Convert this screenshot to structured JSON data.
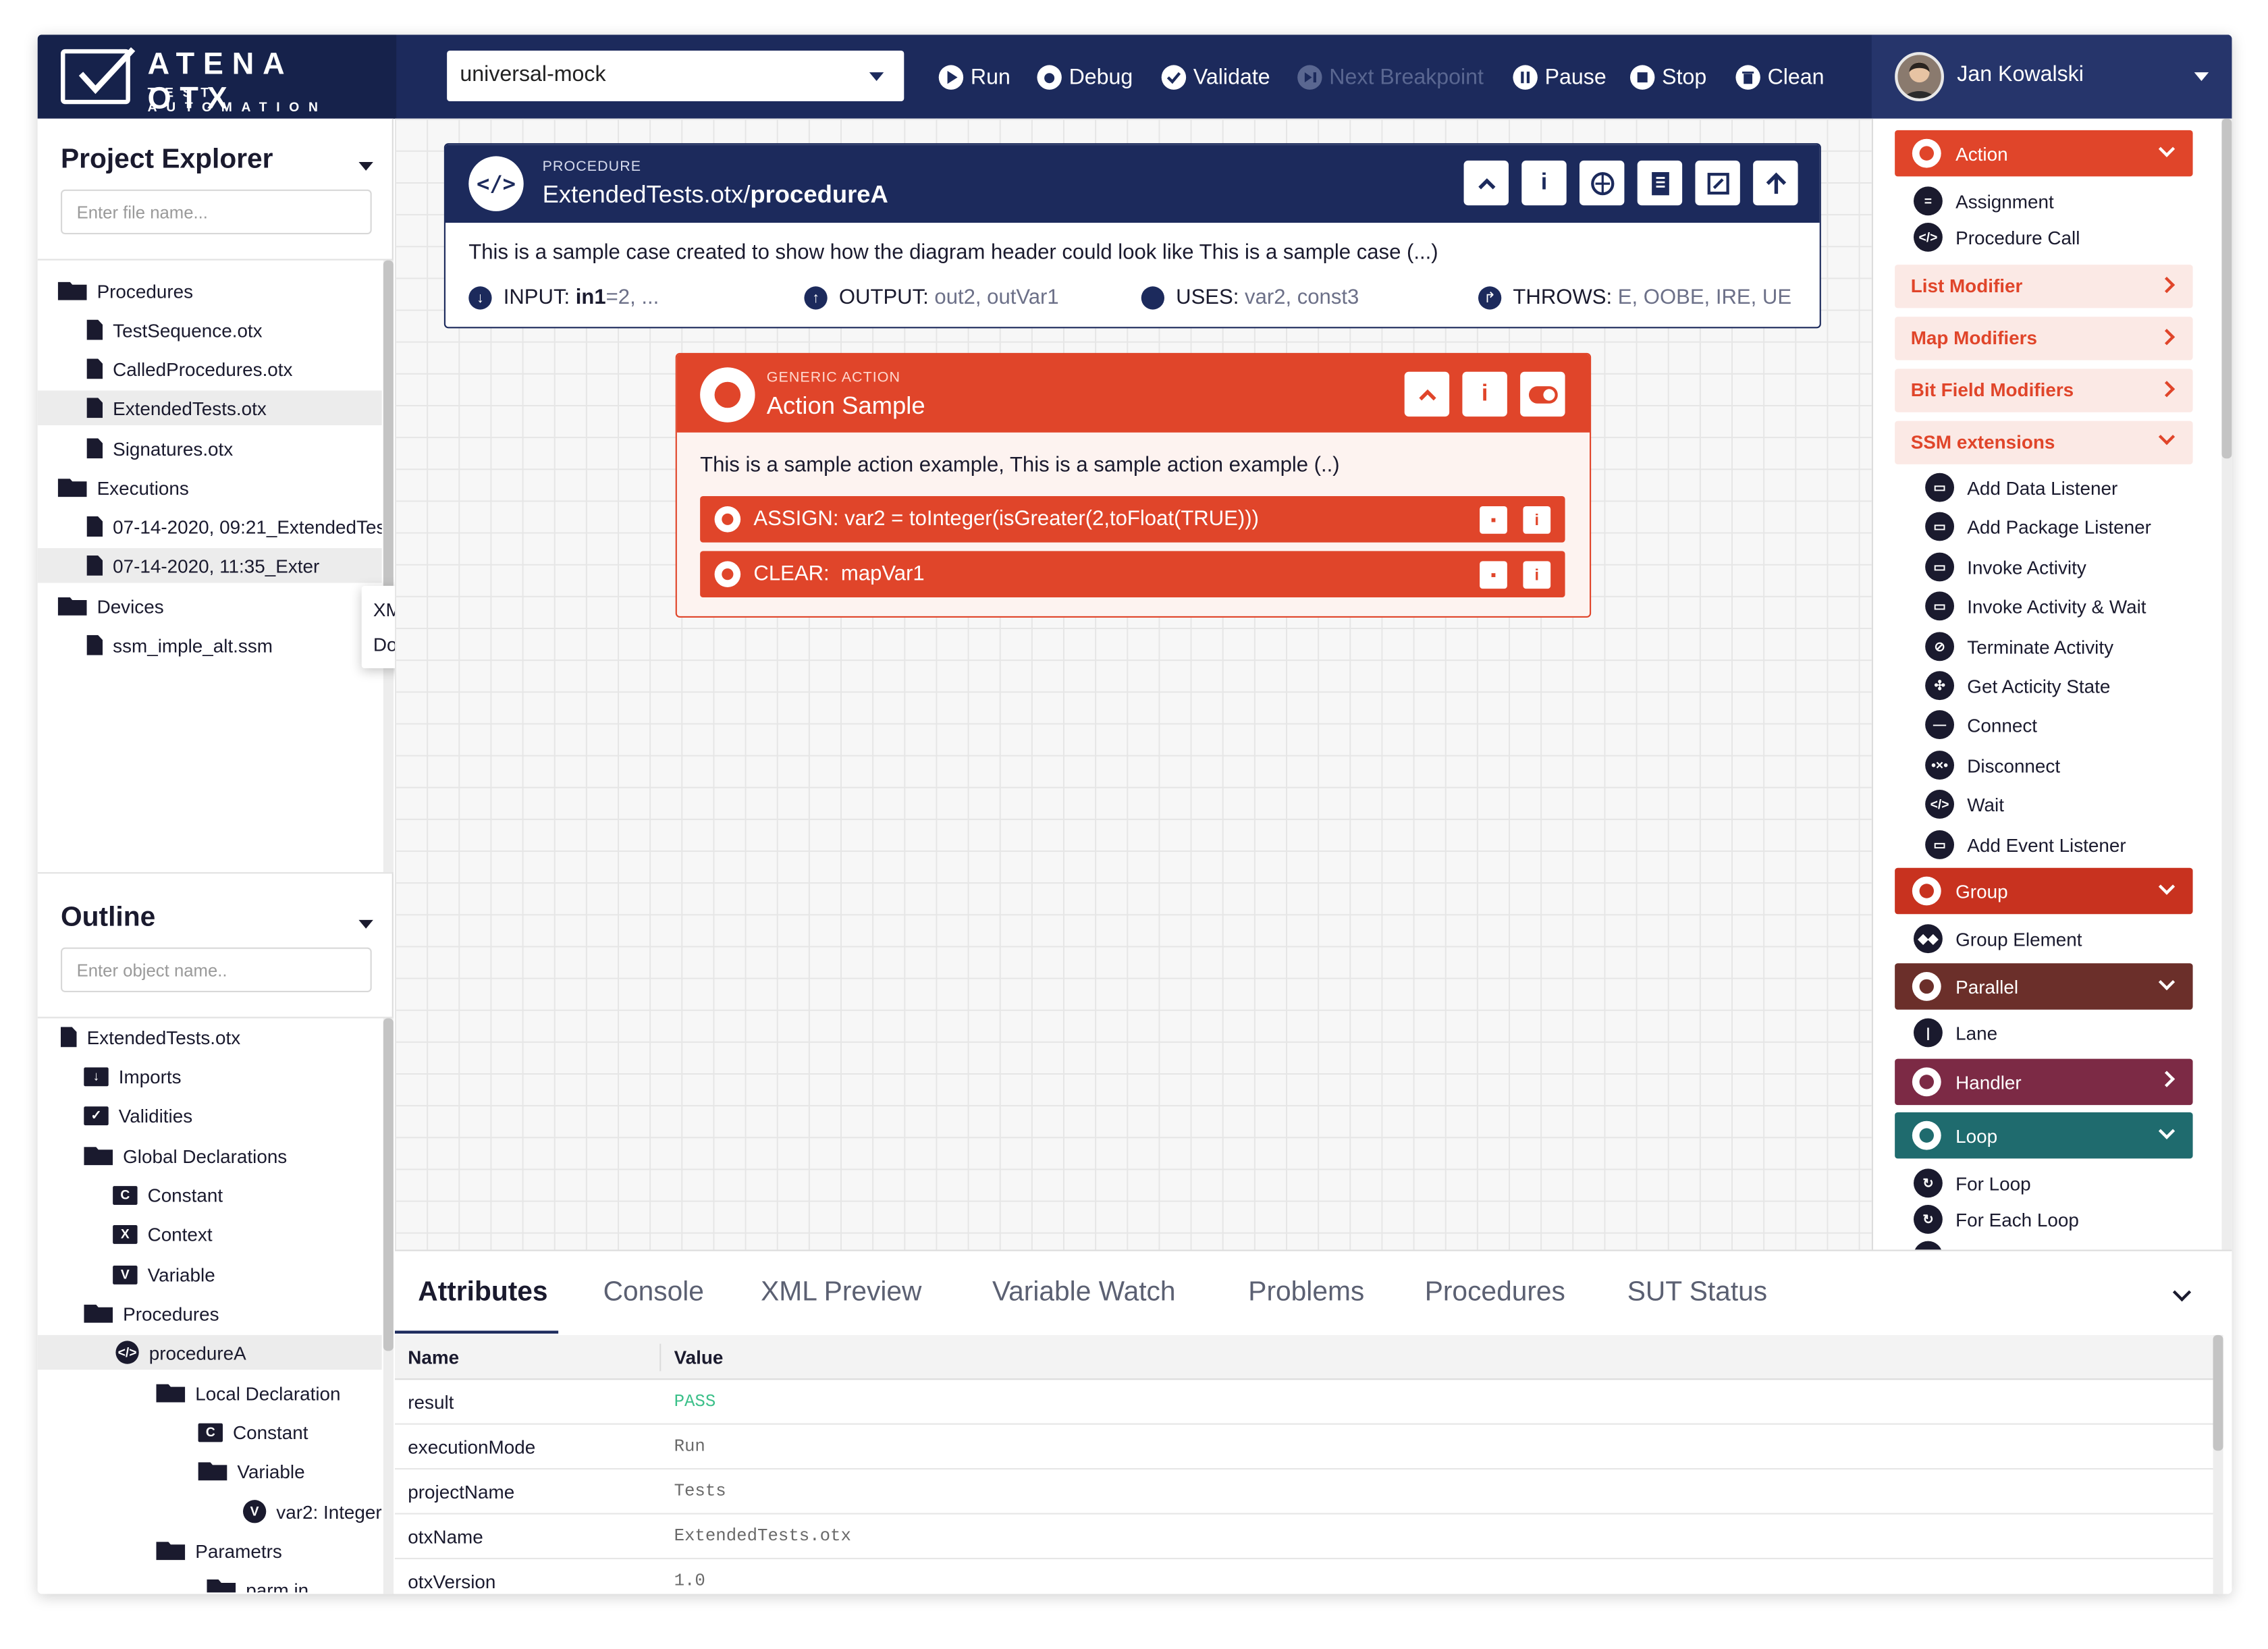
{
  "logo": {
    "title": "ATENA OTX",
    "subtitle": "TEST AUTOMATION"
  },
  "toolbar": {
    "device": "universal-mock",
    "run": "Run",
    "debug": "Debug",
    "validate": "Validate",
    "next_breakpoint": "Next Breakpoint",
    "pause": "Pause",
    "stop": "Stop",
    "clean": "Clean"
  },
  "user": {
    "name": "Jan Kowalski"
  },
  "project_explorer": {
    "title": "Project Explorer",
    "placeholder": "Enter file name...",
    "items": [
      "Procedures",
      "TestSequence.otx",
      "CalledProcedures.otx",
      "ExtendedTests.otx",
      "Signatures.otx",
      "Executions",
      "07-14-2020, 09:21_ExtendedTes",
      "07-14-2020, 11:35_Exter",
      "Devices",
      "ssm_imple_alt.ssm"
    ]
  },
  "context_menu": {
    "items": [
      "XML report",
      "Docs report"
    ]
  },
  "outline": {
    "title": "Outline",
    "placeholder": "Enter object name..",
    "items": [
      "ExtendedTests.otx",
      "Imports",
      "Validities",
      "Global Declarations",
      "Constant",
      "Context",
      "Variable",
      "Procedures",
      "procedureA",
      "Local Declaration",
      "Constant",
      "Variable",
      "var2: Integer",
      "Parametrs",
      "parm in"
    ],
    "icon_letters": {
      "constant": "C",
      "context": "X",
      "variable": "V"
    }
  },
  "procedure": {
    "kind": "PROCEDURE",
    "name_prefix": "ExtendedTests.otx/",
    "name_bold": "procedureA",
    "description": "This is a sample case created to show how the diagram header could look like This is a sample case (...)",
    "input_label": "INPUT:",
    "input_name": "in1",
    "input_value": "=2, ...",
    "output_label": "OUTPUT:",
    "output_value": "out2, outVar1",
    "uses_label": "USES:",
    "uses_value": "var2, const3",
    "throws_label": "THROWS:",
    "throws_value": "E, OOBE, IRE, UE"
  },
  "action": {
    "kind": "GENERIC ACTION",
    "name": "Action Sample",
    "description": "This is a sample action example, This is a sample action example (..)",
    "rows": [
      "ASSIGN: var2 = toInteger(isGreater(2,toFloat(TRUE)))",
      "CLEAR:  mapVar1"
    ]
  },
  "palette": {
    "action": "Action",
    "assignment": "Assignment",
    "procedure_call": "Procedure Call",
    "list_modifier": "List Modifier",
    "map_modifiers": "Map Modifiers",
    "bit_field_modifiers": "Bit Field Modifiers",
    "ssm_extensions": "SSM extensions",
    "ssm_items": [
      "Add Data Listener",
      "Add Package Listener",
      "Invoke Activity",
      "Invoke Activity & Wait",
      "Terminate Activity",
      "Get Acticity State",
      "Connect",
      "Disconnect",
      "Wait",
      "Add Event Listener"
    ],
    "group": "Group",
    "group_element": "Group Element",
    "parallel": "Parallel",
    "lane": "Lane",
    "handler": "Handler",
    "loop": "Loop",
    "for_loop": "For Loop",
    "for_each_loop": "For Each Loop",
    "colors": {
      "action": "#e0452a",
      "group": "#c8321f",
      "parallel": "#6b2f2a",
      "handler": "#7c2a45",
      "loop": "#1f6b6e"
    }
  },
  "bottom_panel": {
    "tabs": [
      "Attributes",
      "Console",
      "XML Preview",
      "Variable Watch",
      "Problems",
      "Procedures",
      "SUT Status"
    ],
    "columns": [
      "Name",
      "Value"
    ],
    "rows": [
      {
        "name": "result",
        "value": "PASS"
      },
      {
        "name": "executionMode",
        "value": "Run"
      },
      {
        "name": "projectName",
        "value": "Tests"
      },
      {
        "name": "otxName",
        "value": "ExtendedTests.otx"
      },
      {
        "name": "otxVersion",
        "value": "1.0"
      }
    ],
    "pass_color": "#3cc08a"
  }
}
